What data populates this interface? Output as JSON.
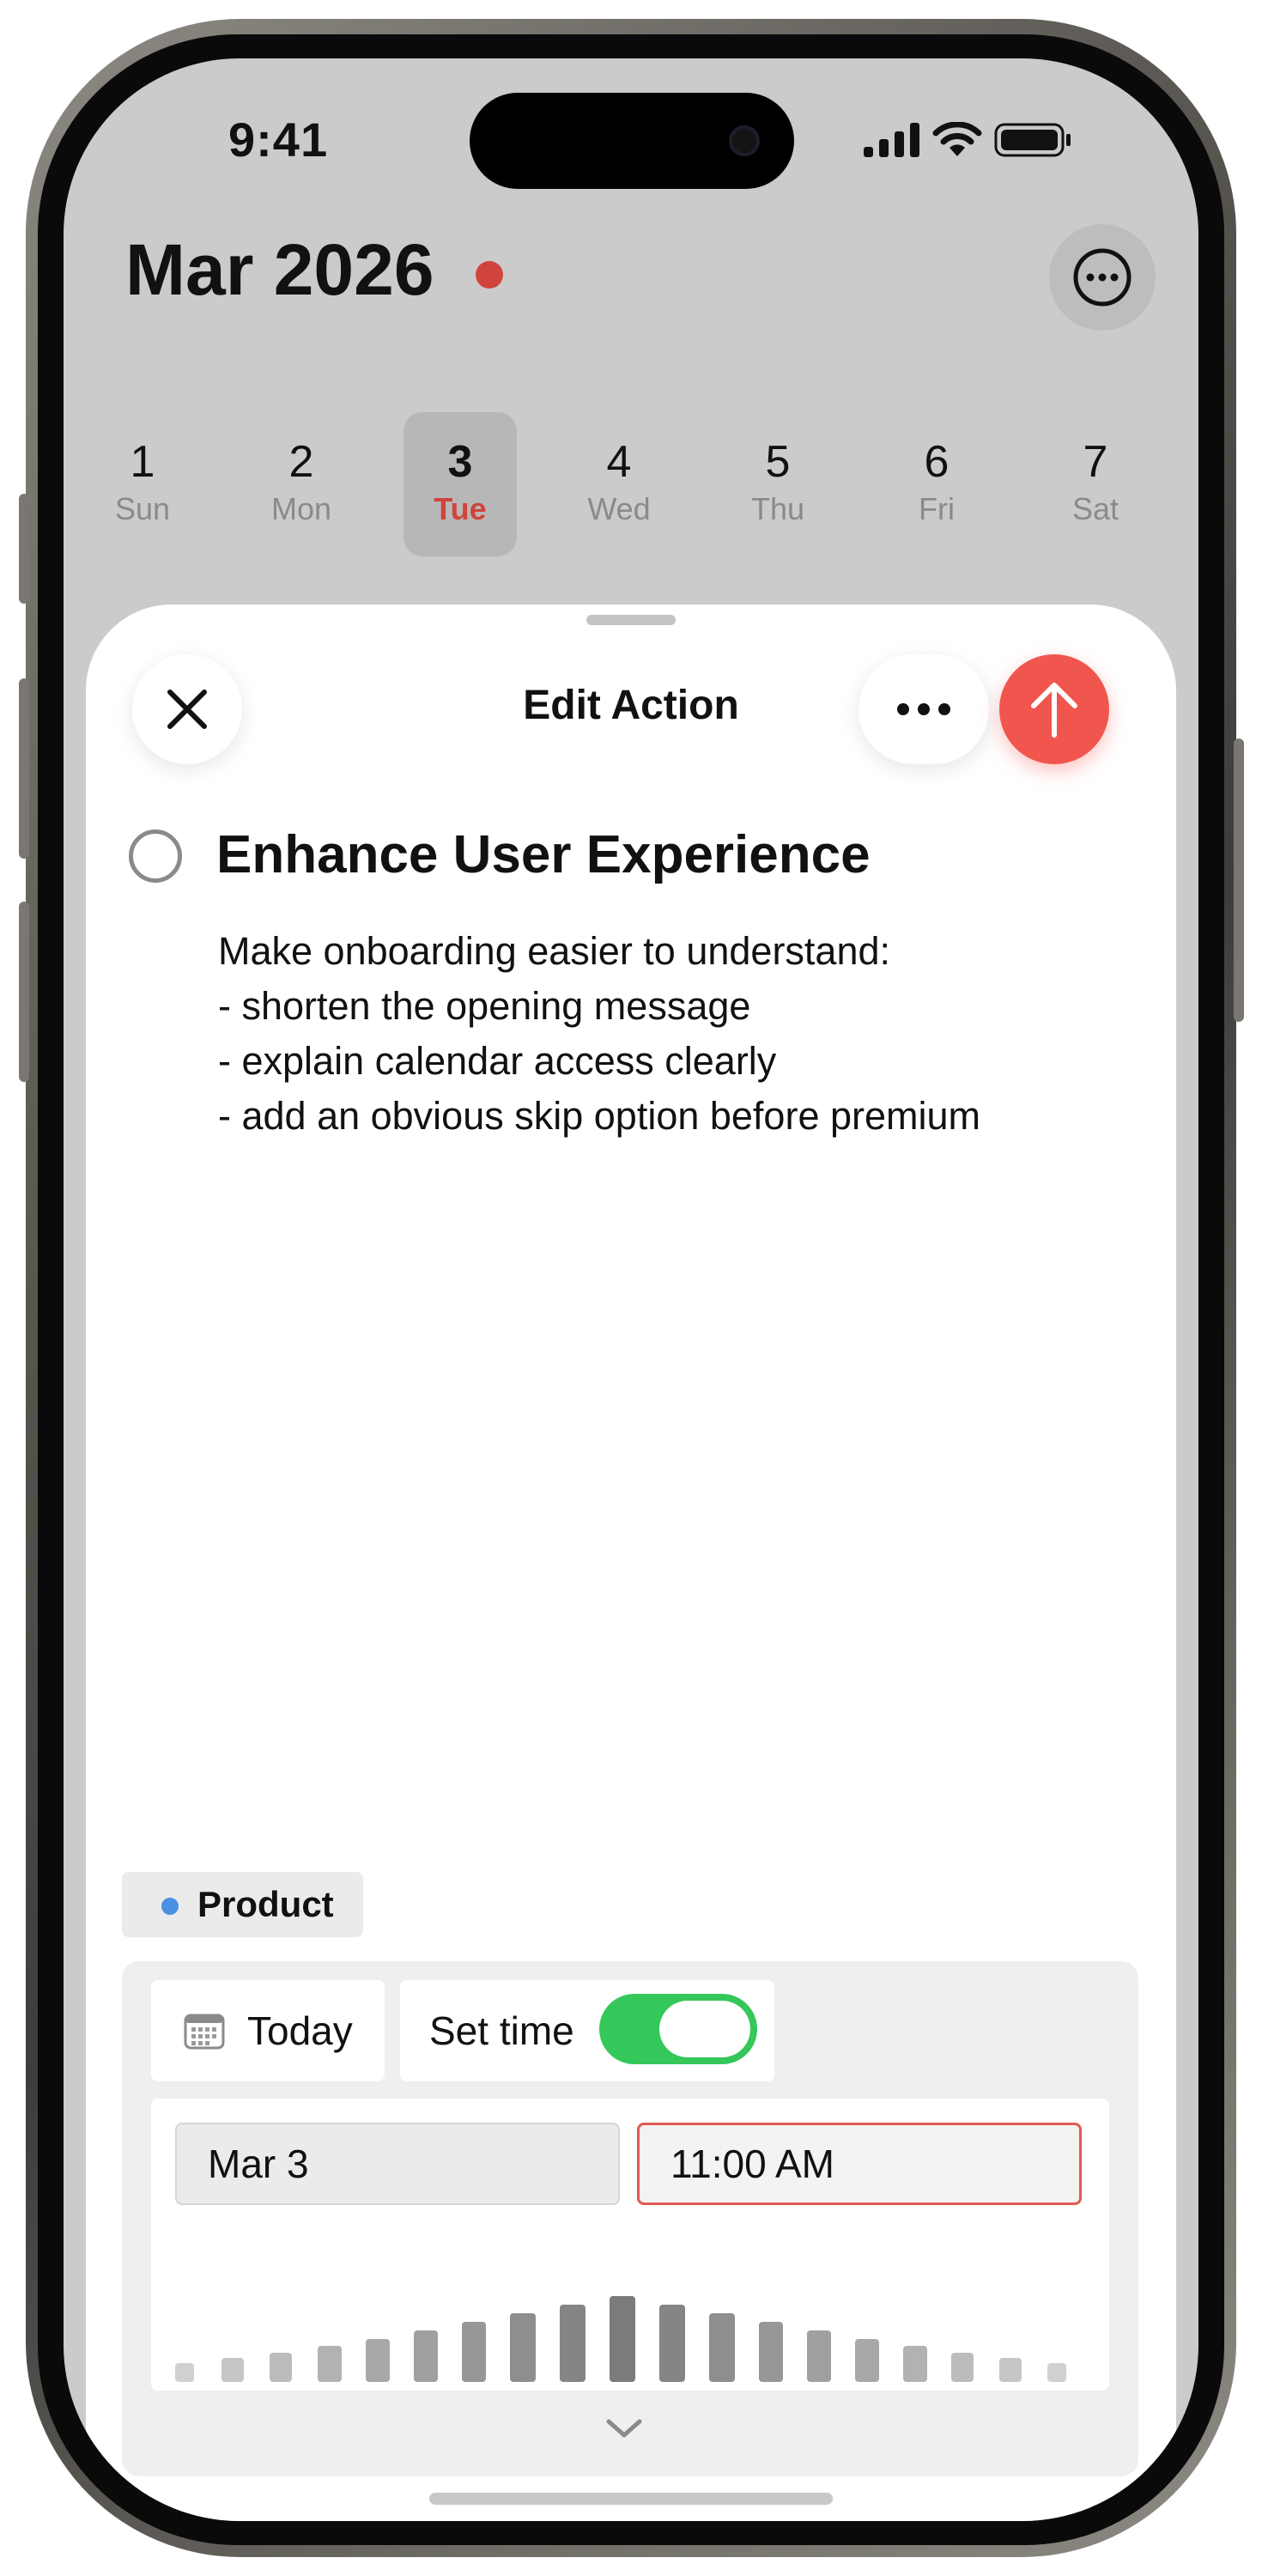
{
  "status_bar": {
    "time": "9:41"
  },
  "header": {
    "month_title": "Mar 2026",
    "accent_color": "#d0443c"
  },
  "week": {
    "days": [
      {
        "num": "1",
        "name": "Sun",
        "selected": false
      },
      {
        "num": "2",
        "name": "Mon",
        "selected": false
      },
      {
        "num": "3",
        "name": "Tue",
        "selected": true
      },
      {
        "num": "4",
        "name": "Wed",
        "selected": false
      },
      {
        "num": "5",
        "name": "Thu",
        "selected": false
      },
      {
        "num": "6",
        "name": "Fri",
        "selected": false
      },
      {
        "num": "7",
        "name": "Sat",
        "selected": false
      }
    ]
  },
  "sheet": {
    "title": "Edit Action",
    "task_title": "Enhance User Experience",
    "notes": [
      "Make onboarding easier to understand:",
      "- shorten the opening message",
      "- explain calendar access clearly",
      "- add an obvious skip option before premium"
    ],
    "tag": {
      "label": "Product",
      "color": "#4a90e2"
    },
    "schedule": {
      "day_chip": "Today",
      "set_time_label": "Set time",
      "set_time_enabled": true,
      "date_value": "Mar 3",
      "time_value": "11:00 AM"
    },
    "send_color": "#f0564d",
    "toggle_color": "#34c759"
  }
}
